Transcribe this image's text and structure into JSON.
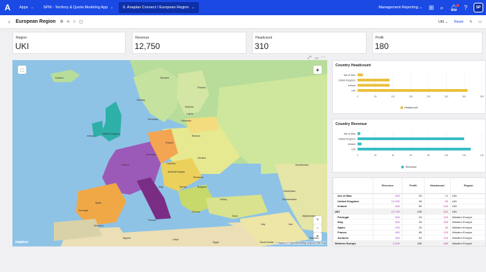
{
  "topbar": {
    "logo": "A",
    "crumbs": [
      {
        "label": "Apps",
        "active": false
      },
      {
        "label": "SPM - Territory & Quota Modeling App",
        "active": false
      },
      {
        "label": "6. Anaplan Connect / European Region",
        "active": true
      }
    ],
    "management": "Management Reporting",
    "avatar": "SP"
  },
  "subbar": {
    "title": "European Region",
    "dropdown": "UKI",
    "reset": "Reset"
  },
  "kpis": [
    {
      "label": "Region",
      "value": "UKI"
    },
    {
      "label": "Revenue",
      "value": "12,750"
    },
    {
      "label": "Headcount",
      "value": "310"
    },
    {
      "label": "Profit",
      "value": "180"
    }
  ],
  "map": {
    "attribution": "© Mapbox © OpenStreetMap  Improve this map",
    "mapbox": "mapbox",
    "zoom_in": "+",
    "zoom_out": "−",
    "labels": [
      {
        "name": "Iceland"
      },
      {
        "name": "Sweden"
      },
      {
        "name": "Finland"
      },
      {
        "name": "Norway"
      },
      {
        "name": "Estonia"
      },
      {
        "name": "Latvia"
      },
      {
        "name": "Lithuania"
      },
      {
        "name": "Denmark"
      },
      {
        "name": "United Kingdom"
      },
      {
        "name": "Ireland"
      },
      {
        "name": "Belarus"
      },
      {
        "name": "Poland"
      },
      {
        "name": "Germany"
      },
      {
        "name": "Czechia"
      },
      {
        "name": "Ukraine"
      },
      {
        "name": "France"
      },
      {
        "name": "Austria"
      },
      {
        "name": "Hungary"
      },
      {
        "name": "Romania"
      },
      {
        "name": "Italy"
      },
      {
        "name": "Serbia"
      },
      {
        "name": "Bulgaria"
      },
      {
        "name": "Spain"
      },
      {
        "name": "Portugal"
      },
      {
        "name": "Greece"
      },
      {
        "name": "Turkey"
      },
      {
        "name": "Kazakhstan"
      },
      {
        "name": "Uzbekistan"
      },
      {
        "name": "Turkmenistan"
      },
      {
        "name": "Syria"
      },
      {
        "name": "Iraq"
      },
      {
        "name": "Iran"
      },
      {
        "name": "Afghanistan"
      },
      {
        "name": "Pakistan"
      },
      {
        "name": "Tunisia"
      },
      {
        "name": "Morocco"
      },
      {
        "name": "Algeria"
      },
      {
        "name": "Libya"
      },
      {
        "name": "Egypt"
      },
      {
        "name": "Saudi Arabia"
      }
    ]
  },
  "headcount_chart": {
    "title": "Country Headcount",
    "legend": "Headcount",
    "color": "#e8c13d",
    "chart_data": {
      "type": "bar",
      "categories": [
        "Isle of Man",
        "United Kingdom",
        "Ireland",
        "UKI"
      ],
      "values": [
        15,
        90,
        90,
        310
      ],
      "xlim": [
        0,
        350
      ],
      "ticks": [
        "0",
        "50",
        "100",
        "150",
        "200",
        "250",
        "300",
        "350"
      ]
    }
  },
  "revenue_chart": {
    "title": "Country Revenue",
    "legend": "Revenue",
    "color": "#3bbcc6",
    "chart_data": {
      "type": "bar",
      "categories": [
        "Isle of Man",
        "United Kingdom",
        "Ireland",
        "UKI"
      ],
      "values": [
        300,
        12000,
        450,
        12750
      ],
      "xlim": [
        0,
        14000
      ],
      "ticks": [
        "0",
        "2k",
        "4k",
        "6k",
        "8k",
        "10k",
        "12k",
        "14k"
      ]
    }
  },
  "table": {
    "columns": [
      "",
      "Revenue",
      "Profit",
      "Headcount",
      "Region"
    ],
    "rows": [
      {
        "label": "Isle of Man",
        "level": 1,
        "revenue": "300",
        "profit": "20",
        "headcount": "15",
        "region": "UKI"
      },
      {
        "label": "United Kingdom",
        "level": 1,
        "revenue": "12,000",
        "profit": "90",
        "headcount": "90",
        "region": "UKI"
      },
      {
        "label": "Ireland",
        "level": 1,
        "revenue": "450",
        "profit": "80",
        "headcount": "120",
        "region": "UKI"
      },
      {
        "label": "UKI",
        "level": 0,
        "revenue": "12,750",
        "profit": "190",
        "headcount": "310",
        "region": "UKI"
      },
      {
        "label": "Portugal",
        "level": 1,
        "revenue": "500",
        "profit": "20",
        "headcount": "100",
        "region": "Western Europe"
      },
      {
        "label": "Italy",
        "level": 1,
        "revenue": "500",
        "profit": "20",
        "headcount": "100",
        "region": "Western Europe"
      },
      {
        "label": "Spain",
        "level": 1,
        "revenue": "100",
        "profit": "20",
        "headcount": "40",
        "region": "Western Europe"
      },
      {
        "label": "France",
        "level": 1,
        "revenue": "450",
        "profit": "80",
        "headcount": "120",
        "region": "Western Europe"
      },
      {
        "label": "Andorra",
        "level": 1,
        "revenue": "450",
        "profit": "40",
        "headcount": "120",
        "region": "Western Europe"
      },
      {
        "label": "Western Europe",
        "level": 0,
        "revenue": "2,000",
        "profit": "180",
        "headcount": "480",
        "region": "Western Europe"
      }
    ]
  }
}
